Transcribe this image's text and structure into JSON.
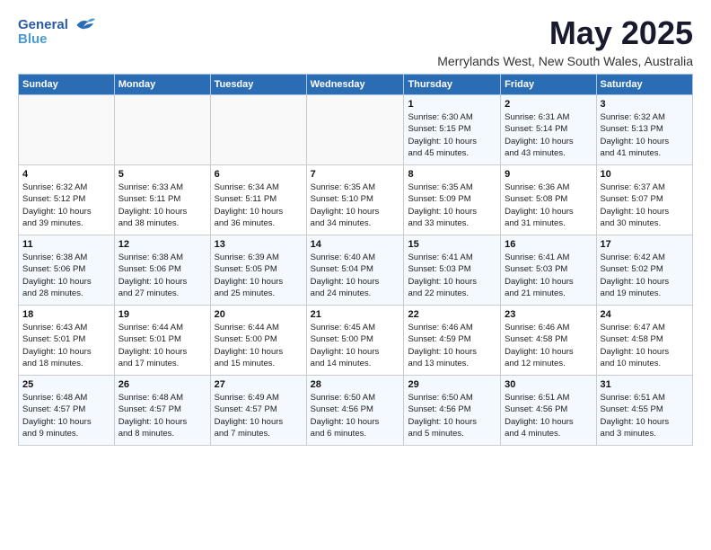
{
  "logo": {
    "line1": "General",
    "line2": "Blue"
  },
  "title": "May 2025",
  "subtitle": "Merrylands West, New South Wales, Australia",
  "weekdays": [
    "Sunday",
    "Monday",
    "Tuesday",
    "Wednesday",
    "Thursday",
    "Friday",
    "Saturday"
  ],
  "weeks": [
    [
      {
        "day": "",
        "info": ""
      },
      {
        "day": "",
        "info": ""
      },
      {
        "day": "",
        "info": ""
      },
      {
        "day": "",
        "info": ""
      },
      {
        "day": "1",
        "info": "Sunrise: 6:30 AM\nSunset: 5:15 PM\nDaylight: 10 hours\nand 45 minutes."
      },
      {
        "day": "2",
        "info": "Sunrise: 6:31 AM\nSunset: 5:14 PM\nDaylight: 10 hours\nand 43 minutes."
      },
      {
        "day": "3",
        "info": "Sunrise: 6:32 AM\nSunset: 5:13 PM\nDaylight: 10 hours\nand 41 minutes."
      }
    ],
    [
      {
        "day": "4",
        "info": "Sunrise: 6:32 AM\nSunset: 5:12 PM\nDaylight: 10 hours\nand 39 minutes."
      },
      {
        "day": "5",
        "info": "Sunrise: 6:33 AM\nSunset: 5:11 PM\nDaylight: 10 hours\nand 38 minutes."
      },
      {
        "day": "6",
        "info": "Sunrise: 6:34 AM\nSunset: 5:11 PM\nDaylight: 10 hours\nand 36 minutes."
      },
      {
        "day": "7",
        "info": "Sunrise: 6:35 AM\nSunset: 5:10 PM\nDaylight: 10 hours\nand 34 minutes."
      },
      {
        "day": "8",
        "info": "Sunrise: 6:35 AM\nSunset: 5:09 PM\nDaylight: 10 hours\nand 33 minutes."
      },
      {
        "day": "9",
        "info": "Sunrise: 6:36 AM\nSunset: 5:08 PM\nDaylight: 10 hours\nand 31 minutes."
      },
      {
        "day": "10",
        "info": "Sunrise: 6:37 AM\nSunset: 5:07 PM\nDaylight: 10 hours\nand 30 minutes."
      }
    ],
    [
      {
        "day": "11",
        "info": "Sunrise: 6:38 AM\nSunset: 5:06 PM\nDaylight: 10 hours\nand 28 minutes."
      },
      {
        "day": "12",
        "info": "Sunrise: 6:38 AM\nSunset: 5:06 PM\nDaylight: 10 hours\nand 27 minutes."
      },
      {
        "day": "13",
        "info": "Sunrise: 6:39 AM\nSunset: 5:05 PM\nDaylight: 10 hours\nand 25 minutes."
      },
      {
        "day": "14",
        "info": "Sunrise: 6:40 AM\nSunset: 5:04 PM\nDaylight: 10 hours\nand 24 minutes."
      },
      {
        "day": "15",
        "info": "Sunrise: 6:41 AM\nSunset: 5:03 PM\nDaylight: 10 hours\nand 22 minutes."
      },
      {
        "day": "16",
        "info": "Sunrise: 6:41 AM\nSunset: 5:03 PM\nDaylight: 10 hours\nand 21 minutes."
      },
      {
        "day": "17",
        "info": "Sunrise: 6:42 AM\nSunset: 5:02 PM\nDaylight: 10 hours\nand 19 minutes."
      }
    ],
    [
      {
        "day": "18",
        "info": "Sunrise: 6:43 AM\nSunset: 5:01 PM\nDaylight: 10 hours\nand 18 minutes."
      },
      {
        "day": "19",
        "info": "Sunrise: 6:44 AM\nSunset: 5:01 PM\nDaylight: 10 hours\nand 17 minutes."
      },
      {
        "day": "20",
        "info": "Sunrise: 6:44 AM\nSunset: 5:00 PM\nDaylight: 10 hours\nand 15 minutes."
      },
      {
        "day": "21",
        "info": "Sunrise: 6:45 AM\nSunset: 5:00 PM\nDaylight: 10 hours\nand 14 minutes."
      },
      {
        "day": "22",
        "info": "Sunrise: 6:46 AM\nSunset: 4:59 PM\nDaylight: 10 hours\nand 13 minutes."
      },
      {
        "day": "23",
        "info": "Sunrise: 6:46 AM\nSunset: 4:58 PM\nDaylight: 10 hours\nand 12 minutes."
      },
      {
        "day": "24",
        "info": "Sunrise: 6:47 AM\nSunset: 4:58 PM\nDaylight: 10 hours\nand 10 minutes."
      }
    ],
    [
      {
        "day": "25",
        "info": "Sunrise: 6:48 AM\nSunset: 4:57 PM\nDaylight: 10 hours\nand 9 minutes."
      },
      {
        "day": "26",
        "info": "Sunrise: 6:48 AM\nSunset: 4:57 PM\nDaylight: 10 hours\nand 8 minutes."
      },
      {
        "day": "27",
        "info": "Sunrise: 6:49 AM\nSunset: 4:57 PM\nDaylight: 10 hours\nand 7 minutes."
      },
      {
        "day": "28",
        "info": "Sunrise: 6:50 AM\nSunset: 4:56 PM\nDaylight: 10 hours\nand 6 minutes."
      },
      {
        "day": "29",
        "info": "Sunrise: 6:50 AM\nSunset: 4:56 PM\nDaylight: 10 hours\nand 5 minutes."
      },
      {
        "day": "30",
        "info": "Sunrise: 6:51 AM\nSunset: 4:56 PM\nDaylight: 10 hours\nand 4 minutes."
      },
      {
        "day": "31",
        "info": "Sunrise: 6:51 AM\nSunset: 4:55 PM\nDaylight: 10 hours\nand 3 minutes."
      }
    ]
  ]
}
